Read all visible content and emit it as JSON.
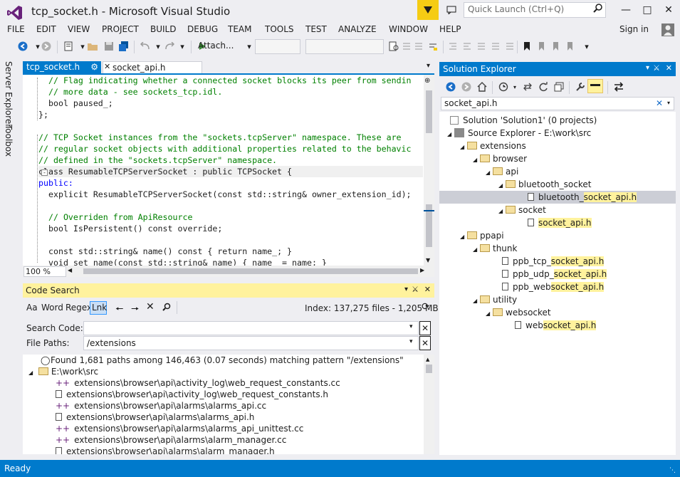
{
  "window": {
    "title": "tcp_socket.h - Microsoft Visual Studio",
    "quick_launch_placeholder": "Quick Launch (Ctrl+Q)"
  },
  "menu": [
    "FILE",
    "EDIT",
    "VIEW",
    "PROJECT",
    "BUILD",
    "DEBUG",
    "TEAM",
    "TOOLS",
    "TEST",
    "ANALYZE",
    "WINDOW",
    "HELP"
  ],
  "account": {
    "sign_in": "Sign in"
  },
  "toolbar": {
    "attach_label": "Attach..."
  },
  "side_tabs": {
    "server_explorer": "Server Explorer",
    "toolbox": "Toolbox"
  },
  "editor": {
    "tabs": [
      {
        "label": "tcp_socket.h",
        "active": true
      },
      {
        "label": "socket_api.h",
        "active": false
      }
    ],
    "zoom": "100 %",
    "lines": [
      "// Flag indicating whether a connected socket blocks its peer from sendin",
      "// more data - see sockets_tcp.idl.",
      "bool paused_;",
      "};",
      "",
      "// TCP Socket instances from the \"sockets.tcpServer\" namespace. These are",
      "// regular socket objects with additional properties related to the behavic",
      "// defined in the \"sockets.tcpServer\" namespace.",
      "class ResumableTCPServerSocket : public TCPSocket {",
      "public:",
      "explicit ResumableTCPServerSocket(const std::string& owner_extension_id);",
      "",
      "// Overriden from ApiResource",
      "bool IsPersistent() const override;",
      "",
      "const std::string& name() const { return name_; }",
      "void set name(const std::string& name) { name_ = name; }"
    ]
  },
  "code_search": {
    "title": "Code Search",
    "options": {
      "case": "Aa",
      "word": "Word",
      "regex": "Regex",
      "link": "Lnk"
    },
    "index_info": "Index: 137,275 files - 1,205 MB",
    "search_code_label": "Search Code:",
    "search_code_value": "",
    "file_paths_label": "File Paths:",
    "file_paths_value": "/extensions",
    "summary": "Found 1,681 paths among 146,463 (0.07 seconds) matching pattern \"/extensions\"",
    "root": "E:\\work\\src",
    "results": [
      "extensions\\browser\\api\\activity_log\\web_request_constants.cc",
      "extensions\\browser\\api\\activity_log\\web_request_constants.h",
      "extensions\\browser\\api\\alarms\\alarms_api.cc",
      "extensions\\browser\\api\\alarms\\alarms_api.h",
      "extensions\\browser\\api\\alarms\\alarms_api_unittest.cc",
      "extensions\\browser\\api\\alarms\\alarm_manager.cc",
      "extensions\\browser\\api\\alarms\\alarm_manager.h"
    ]
  },
  "solution_explorer": {
    "title": "Solution Explorer",
    "search_value": "socket_api.h",
    "solution": "Solution 'Solution1' (0 projects)",
    "source_explorer": "Source Explorer - E:\\work\\src",
    "nodes": {
      "extensions": "extensions",
      "browser": "browser",
      "api": "api",
      "bluetooth_socket": "bluetooth_socket",
      "bt_file_pre": "bluetooth_",
      "bt_file_hl": "socket_api.h",
      "socket": "socket",
      "socket_file_hl": "socket_api.h",
      "ppapi": "ppapi",
      "thunk": "thunk",
      "tcp_pre": "ppb_tcp_",
      "tcp_hl": "socket_api.h",
      "udp_pre": "ppb_udp_",
      "udp_hl": "socket_api.h",
      "web_pre": "ppb_web",
      "web_hl": "socket_api.h",
      "utility": "utility",
      "websocket": "websocket",
      "ws_pre": "web",
      "ws_hl": "socket_api.h"
    }
  },
  "status": {
    "text": "Ready"
  },
  "colors": {
    "accent": "#007acc",
    "highlight": "#fff29d",
    "notification": "#f5cc14"
  }
}
